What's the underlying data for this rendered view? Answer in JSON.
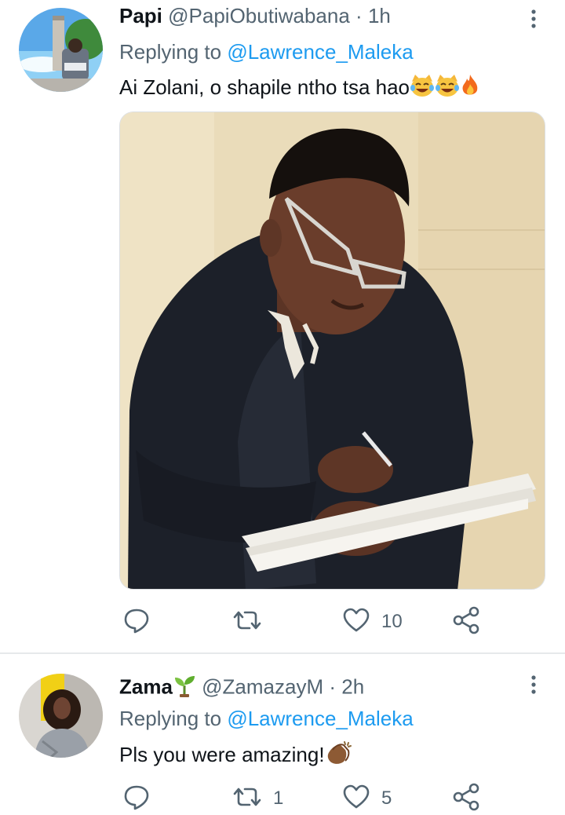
{
  "tweets": [
    {
      "name": "Papi",
      "handle": "@PapiObutiwabana",
      "separator": "·",
      "time": "1h",
      "replying_prefix": "Replying to",
      "replying_to": "@Lawrence_Maleka",
      "text": "Ai Zolani, o shapile ntho tsa hao",
      "text_emojis": [
        "cat-tears-of-joy-emoji",
        "cat-tears-of-joy-emoji",
        "fire-emoji"
      ],
      "has_media": true,
      "reply_count": "",
      "retweet_count": "",
      "like_count": "10"
    },
    {
      "name": "Zama",
      "name_emoji": "seedling-emoji",
      "handle": "@ZamazayM",
      "separator": "·",
      "time": "2h",
      "replying_prefix": "Replying to",
      "replying_to": "@Lawrence_Maleka",
      "text": "Pls you were amazing!",
      "text_emojis": [
        "clapping-hands-emoji"
      ],
      "has_media": false,
      "reply_count": "",
      "retweet_count": "1",
      "like_count": "5"
    }
  ],
  "icons": {
    "reply": "reply-icon",
    "retweet": "retweet-icon",
    "like": "heart-icon",
    "share": "share-icon",
    "more": "more-vertical-icon"
  },
  "colors": {
    "text": "#0f1419",
    "secondary": "#536471",
    "accent": "#1d9bf0",
    "divider": "#e6e9eb"
  }
}
